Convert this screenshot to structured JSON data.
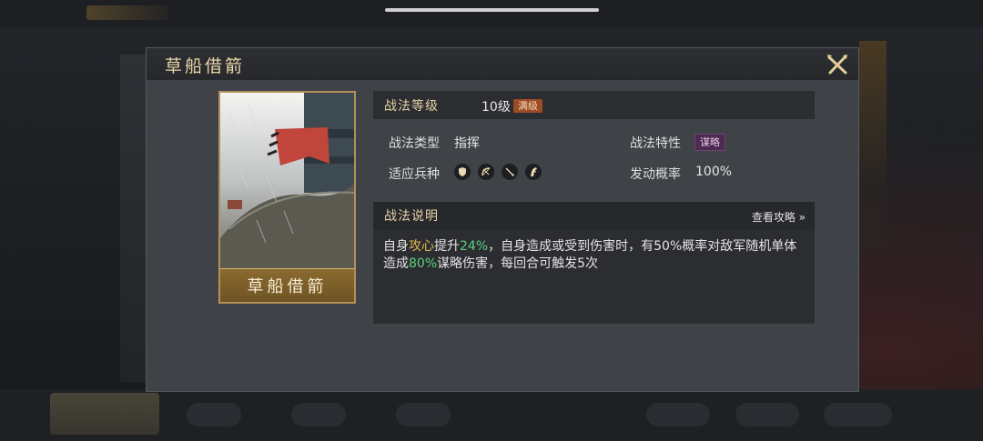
{
  "dialog": {
    "title": "草船借箭",
    "card_label": "草船借箭",
    "level": {
      "label": "战法等级",
      "value": "10级",
      "badge": "满级"
    },
    "type": {
      "label": "战法类型",
      "value": "指挥"
    },
    "trait": {
      "label": "战法特性",
      "value": "谋略"
    },
    "troops": {
      "label": "适应兵种",
      "icons": [
        "shield-icon",
        "bow-icon",
        "spear-icon",
        "horse-icon"
      ]
    },
    "trigger": {
      "label": "发动概率",
      "value": "100%"
    },
    "description": {
      "title": "战法说明",
      "guide_link": "查看攻略 »",
      "segments": [
        {
          "text": "自身",
          "style": "plain"
        },
        {
          "text": "攻心",
          "style": "gold"
        },
        {
          "text": "提升",
          "style": "plain"
        },
        {
          "text": "24%",
          "style": "green"
        },
        {
          "text": "，自身造成或受到伤害时，有50%概率对敌军随机单体造成",
          "style": "plain"
        },
        {
          "text": "80%",
          "style": "green"
        },
        {
          "text": "谋略伤害，每回合可触发5次",
          "style": "plain"
        }
      ]
    }
  },
  "colors": {
    "gold_text": "#e6d2a6",
    "highlight_gold": "#e0b84a",
    "highlight_green": "#5bd07e",
    "badge_max": "#9b4c24",
    "badge_trait": "#4b2b4f"
  }
}
